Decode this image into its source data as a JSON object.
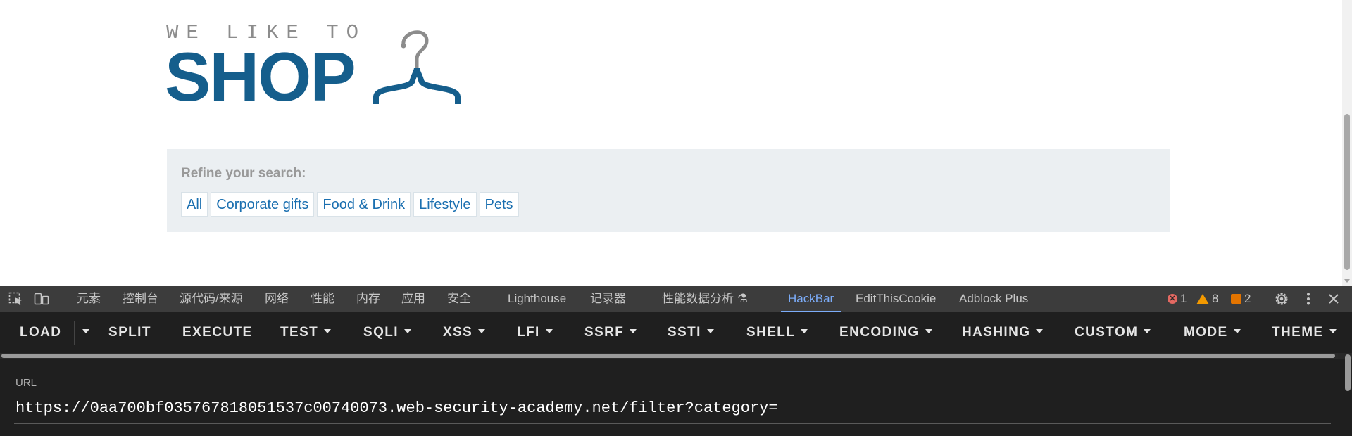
{
  "logo": {
    "tagline": "WE LIKE TO",
    "brand": "SHOP"
  },
  "refine": {
    "title": "Refine your search:",
    "filters": [
      "All",
      "Corporate gifts",
      "Food & Drink",
      "Lifestyle",
      "Pets"
    ]
  },
  "devtools": {
    "tabs": [
      {
        "label": "元素"
      },
      {
        "label": "控制台"
      },
      {
        "label": "源代码/来源"
      },
      {
        "label": "网络"
      },
      {
        "label": "性能"
      },
      {
        "label": "内存"
      },
      {
        "label": "应用"
      },
      {
        "label": "安全"
      },
      {
        "label": "Lighthouse"
      },
      {
        "label": "记录器"
      },
      {
        "label": "性能数据分析 ⚗"
      },
      {
        "label": "HackBar",
        "active": true
      },
      {
        "label": "EditThisCookie"
      },
      {
        "label": "Adblock Plus"
      }
    ],
    "errors": "1",
    "warnings": "8",
    "issues": "2"
  },
  "hackbar": {
    "buttons": {
      "load": "LOAD",
      "split": "SPLIT",
      "execute": "EXECUTE",
      "test": "TEST",
      "sqli": "SQLI",
      "xss": "XSS",
      "lfi": "LFI",
      "ssrf": "SSRF",
      "ssti": "SSTI",
      "shell": "SHELL",
      "encoding": "ENCODING",
      "hashing": "HASHING",
      "custom": "CUSTOM",
      "mode": "MODE",
      "theme": "THEME"
    },
    "url_label": "URL",
    "url_value": "https://0aa700bf035767818051537c00740073.web-security-academy.net/filter?category="
  },
  "colors": {
    "brand": "#155e8c",
    "link": "#1a6fb0",
    "refine_bg": "#ebeff2",
    "devtools_active_tab": "#7cacf8",
    "hackbar_bg": "#1f1f1f"
  }
}
